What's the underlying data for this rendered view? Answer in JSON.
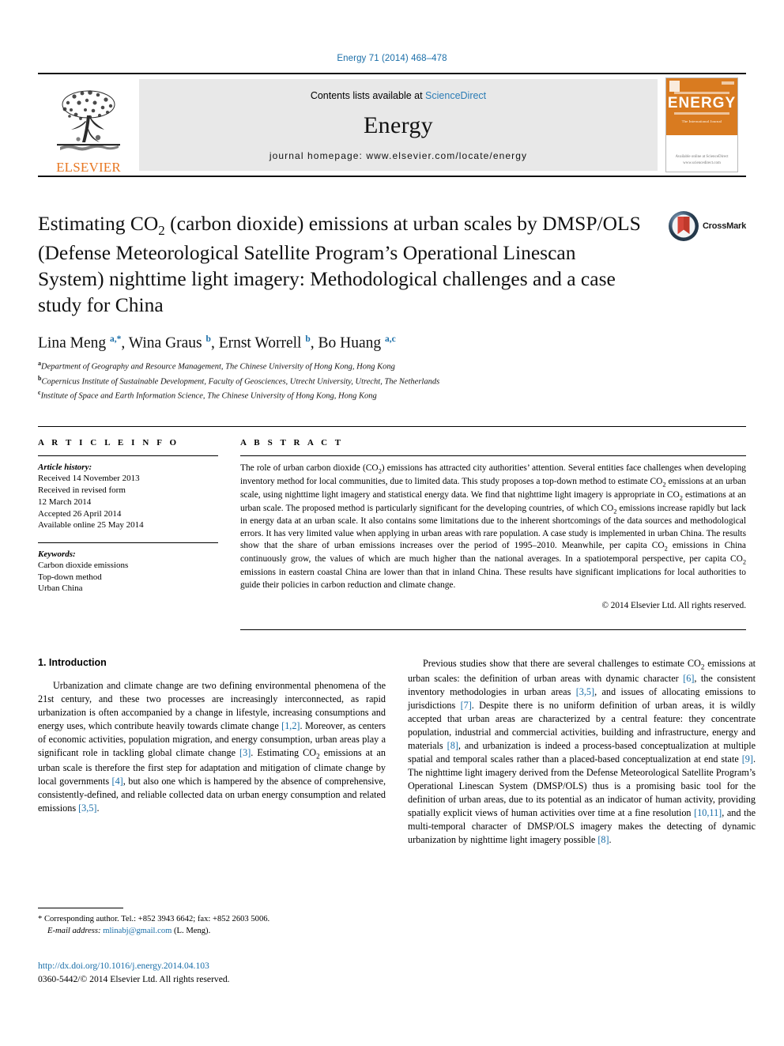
{
  "running_head": "Energy 71 (2014) 468–478",
  "masthead": {
    "contents_prefix": "Contents lists available at ",
    "sciencedirect": "ScienceDirect",
    "journal_title": "Energy",
    "homepage": "journal homepage: www.elsevier.com/locate/energy",
    "publisher_word": "ELSEVIER",
    "publisher_logo_icon": "elsevier-tree-logo",
    "cover": {
      "title": "ENERGY",
      "subtitle": "The International Journal",
      "publisher": "Available online at\nScienceDirect\nwww.sciencedirect.com"
    },
    "link_color": "#2b7cb5"
  },
  "article": {
    "title_html": "Estimating CO<sub>2</sub> (carbon dioxide) emissions at urban scales by DMSP/OLS (Defense Meteorological Satellite Program’s Operational Linescan System) nighttime light imagery: Methodological challenges and a case study for China",
    "crossmark_label": "CrossMark",
    "crossmark_icon": "crossmark-logo-icon",
    "authors_html": "Lina Meng <sup>a,*</sup>, Wina Graus <sup>b</sup>, Ernst Worrell <sup>b</sup>, Bo Huang <sup>a,c</sup>",
    "affiliations": [
      {
        "marker": "a",
        "text": "Department of Geography and Resource Management, The Chinese University of Hong Kong, Hong Kong"
      },
      {
        "marker": "b",
        "text": "Copernicus Institute of Sustainable Development, Faculty of Geosciences, Utrecht University, Utrecht, The Netherlands"
      },
      {
        "marker": "c",
        "text": "Institute of Space and Earth Information Science, The Chinese University of Hong Kong, Hong Kong"
      }
    ]
  },
  "article_info": {
    "heading": "A R T I C L E   I N F O",
    "history_label": "Article history:",
    "history_lines": [
      "Received 14 November 2013",
      "Received in revised form",
      "12 March 2014",
      "Accepted 26 April 2014",
      "Available online 25 May 2014"
    ],
    "keywords_label": "Keywords:",
    "keywords": [
      "Carbon dioxide emissions",
      "Top-down method",
      "Urban China"
    ]
  },
  "abstract": {
    "heading": "A B S T R A C T",
    "body_html": "The role of urban carbon dioxide (CO<sub>2</sub>) emissions has attracted city authorities’ attention. Several entities face challenges when developing inventory method for local communities, due to limited data. This study proposes a top-down method to estimate CO<sub>2</sub> emissions at an urban scale, using nighttime light imagery and statistical energy data. We find that nighttime light imagery is appropriate in CO<sub>2</sub> estimations at an urban scale. The proposed method is particularly significant for the developing countries, of which CO<sub>2</sub> emissions increase rapidly but lack in energy data at an urban scale. It also contains some limitations due to the inherent shortcomings of the data sources and methodological errors. It has very limited value when applying in urban areas with rare population. A case study is implemented in urban China. The results show that the share of urban emissions increases over the period of 1995–2010. Meanwhile, per capita CO<sub>2</sub> emissions in China continuously grow, the values of which are much higher than the national averages. In a spatiotemporal perspective, per capita CO<sub>2</sub> emissions in eastern coastal China are lower than that in inland China. These results have significant implications for local authorities to guide their policies in carbon reduction and climate change.",
    "copyright": "© 2014 Elsevier Ltd. All rights reserved."
  },
  "section": {
    "number_title": "1.  Introduction",
    "left_paragraphs_html": [
      "Urbanization and climate change are two defining environmental phenomena of the 21st century, and these two processes are increasingly interconnected, as rapid urbanization is often accompanied by a change in lifestyle, increasing consumptions and energy uses, which contribute heavily towards climate change <span class=\"cite\">[1,2]</span>. Moreover, as centers of economic activities, population migration, and energy consumption, urban areas play a significant role in tackling global climate change <span class=\"cite\">[3]</span>. Estimating CO<sub>2</sub> emissions at an urban scale is therefore the first step for adaptation and mitigation of climate change by local governments <span class=\"cite\">[4]</span>, but also one which is hampered by the absence of comprehensive, consistently-defined, and reliable collected data on urban energy consumption and related emissions <span class=\"cite\">[3,5]</span>."
    ],
    "right_paragraphs_html": [
      "Previous studies show that there are several challenges to estimate CO<sub>2</sub> emissions at urban scales: the definition of urban areas with dynamic character <span class=\"cite\">[6]</span>, the consistent inventory methodologies in urban areas <span class=\"cite\">[3,5]</span>, and issues of allocating emissions to jurisdictions <span class=\"cite\">[7]</span>. Despite there is no uniform definition of urban areas, it is wildly accepted that urban areas are characterized by a central feature: they concentrate population, industrial and commercial activities, building and infrastructure, energy and materials <span class=\"cite\">[8]</span>, and urbanization is indeed a process-based conceptualization at multiple spatial and temporal scales rather than a placed-based conceptualization at end state <span class=\"cite\">[9]</span>. The nighttime light imagery derived from the Defense Meteorological Satellite Program’s Operational Linescan System (DMSP/OLS) thus is a promising basic tool for the definition of urban areas, due to its potential as an indicator of human activity, providing spatially explicit views of human activities over time at a fine resolution <span class=\"cite\">[10,11]</span>, and the multi-temporal character of DMSP/OLS imagery makes the detecting of dynamic urbanization by nighttime light imagery possible <span class=\"cite\">[8]</span>."
    ]
  },
  "footnote": {
    "corresponding_html": "* Corresponding author. Tel.: +852 3943 6642; fax: +852 2603 5006.",
    "email_label": "E-mail address:",
    "email": "mlinabj@gmail.com",
    "email_suffix": "(L. Meng)."
  },
  "footer": {
    "doi": "http://dx.doi.org/10.1016/j.energy.2014.04.103",
    "issn_line": "0360-5442/© 2014 Elsevier Ltd. All rights reserved."
  },
  "colors": {
    "link": "#1a6ea8",
    "cover_orange": "#D97B20",
    "elsevier_orange": "#E87722"
  }
}
